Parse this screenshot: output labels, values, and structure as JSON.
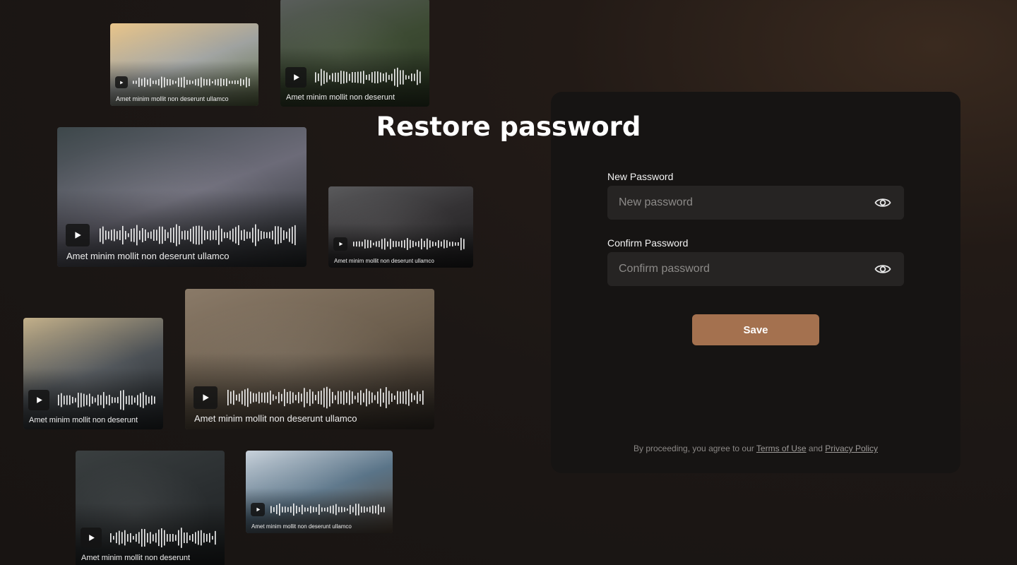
{
  "gallery": [
    {
      "caption": "Amet minim mollit non deserunt ullamco",
      "colors": [
        "#e9c58a",
        "#9fa2a0",
        "#5d6c45"
      ]
    },
    {
      "caption": "Amet minim mollit non deserunt",
      "colors": [
        "#5a5e5c",
        "#3c4a32",
        "#2e3b25"
      ]
    },
    {
      "caption": "Amet minim mollit non deserunt ullamco",
      "colors": [
        "#3d474a",
        "#6c6b78",
        "#262a2c"
      ]
    },
    {
      "caption": "Amet minim mollit non deserunt ullamco",
      "colors": [
        "#5a5a5c",
        "#343234",
        "#1f1e1f"
      ]
    },
    {
      "caption": "Amet minim mollit non deserunt",
      "colors": [
        "#c3b08a",
        "#4b5055",
        "#23272a"
      ]
    },
    {
      "caption": "Amet minim mollit non deserunt ullamco",
      "colors": [
        "#8a7a68",
        "#6c5e4d",
        "#39312a"
      ]
    },
    {
      "caption": "Amet minim mollit non deserunt",
      "colors": [
        "#3a3f40",
        "#2a2e30",
        "#1e2122"
      ]
    },
    {
      "caption": "Amet minim mollit non deserunt ullamco",
      "colors": [
        "#c9d2db",
        "#5a7488",
        "#5a4a3c"
      ]
    }
  ],
  "form": {
    "title": "Restore password",
    "new_password_label": "New Password",
    "new_password_placeholder": "New password",
    "confirm_password_label": "Confirm Password",
    "confirm_password_placeholder": "Confirm password",
    "save_label": "Save"
  },
  "legal": {
    "prefix": "By proceeding, you agree to our ",
    "terms": "Terms of Use",
    "and": " and ",
    "privacy": "Privacy Policy"
  },
  "colors": {
    "accent": "#a4714f",
    "panel": "#161413",
    "field": "#262423"
  },
  "icons": {
    "play": "play-icon",
    "eye": "eye-icon"
  }
}
